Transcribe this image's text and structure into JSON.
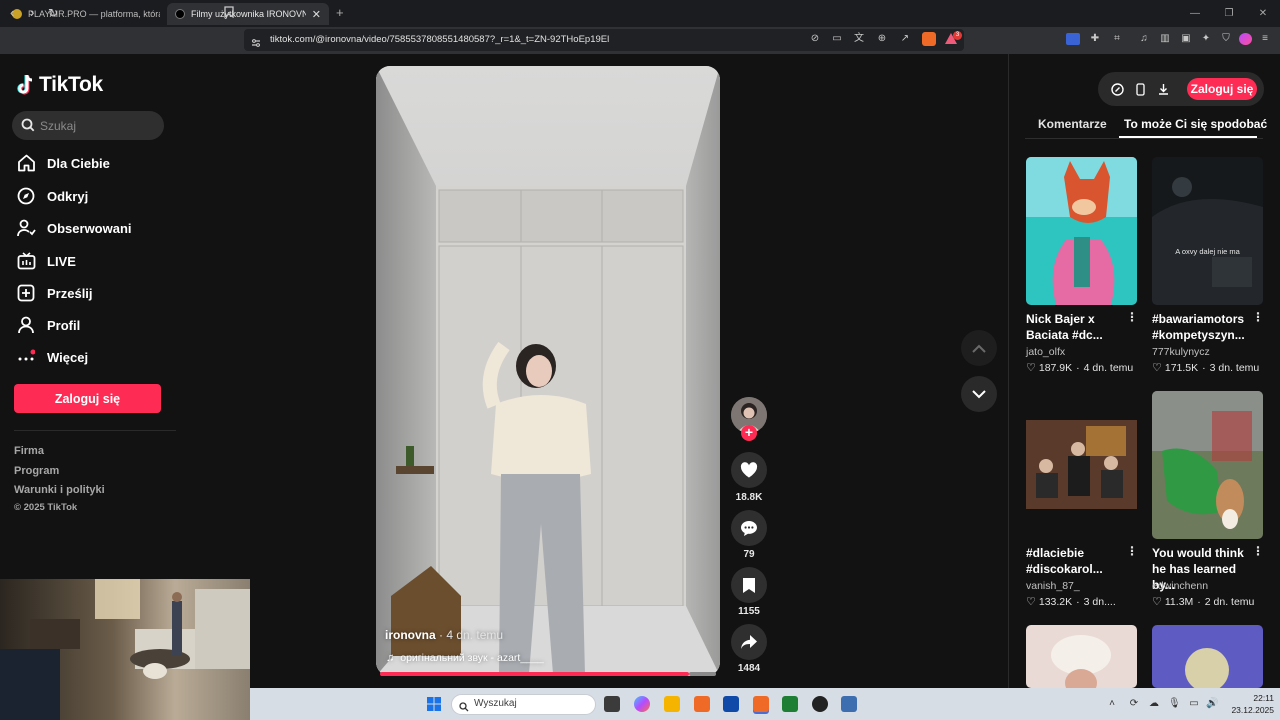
{
  "browser": {
    "tabs": [
      {
        "title": "PLAYAIR.PRO — platforma, która łącz",
        "active": false
      },
      {
        "title": "Filmy użytkownika IRONOVNA (",
        "active": true
      }
    ],
    "new_tab": "+",
    "url": "tiktok.com/@ironovna/video/7585537808551480587?_r=1&_t=ZN-92THoEp19El",
    "notification_count": "3"
  },
  "sidebar": {
    "logo_text": "TikTok",
    "search_placeholder": "Szukaj",
    "nav": [
      {
        "label": "Dla Ciebie",
        "icon": "home-icon"
      },
      {
        "label": "Odkryj",
        "icon": "compass-icon"
      },
      {
        "label": "Obserwowani",
        "icon": "following-icon"
      },
      {
        "label": "LIVE",
        "icon": "live-icon"
      },
      {
        "label": "Prześlij",
        "icon": "upload-icon"
      },
      {
        "label": "Profil",
        "icon": "profile-icon"
      },
      {
        "label": "Więcej",
        "icon": "more-icon"
      }
    ],
    "login_label": "Zaloguj się",
    "footer_links": [
      "Firma",
      "Program",
      "Warunki i polityki"
    ],
    "copyright": "© 2025 TikTok"
  },
  "video": {
    "author": "ironovna",
    "posted": " · 4 dn. temu",
    "sound": "оригінальний звук - azart____",
    "progress": 0.92,
    "likes": "18.8K",
    "comments": "79",
    "saves": "1155",
    "shares": "1484"
  },
  "right_panel": {
    "login_label": "Zaloguj się",
    "tabs": [
      "Komentarze",
      "To może Ci się spodobać"
    ],
    "active_tab": 1,
    "cards": [
      {
        "title": "Nick Bajer x Baciata #dc...",
        "user": "jato_olfx",
        "likes": "187.9K",
        "time": "4 dn. temu",
        "overlay": ""
      },
      {
        "title": "#bawariamotors #kompetyszyn...",
        "user": "777kulynycz",
        "likes": "171.5K",
        "time": "3 dn. temu",
        "overlay": "A oxvy dalej nie ma"
      },
      {
        "title": "#dlaciebie #discokarol...",
        "user": "vanish_87_",
        "likes": "133.2K",
        "time": "3 dn....",
        "overlay": ""
      },
      {
        "title": "You would think he has learned by...",
        "user": "edwinchenn",
        "likes": "11.3M",
        "time": "2 dn. temu",
        "overlay": ""
      }
    ]
  },
  "taskbar": {
    "search_label": "Wyszukaj",
    "time": "22:11",
    "date": "23.12.2025"
  }
}
